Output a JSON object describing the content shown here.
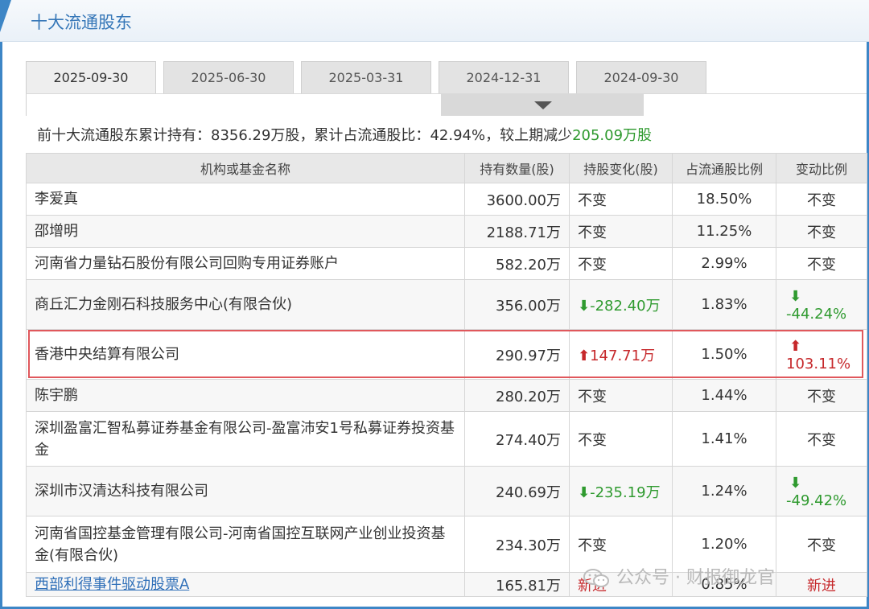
{
  "page": {
    "title": "十大流通股东"
  },
  "tabs": [
    {
      "label": "2025-09-30",
      "active": true
    },
    {
      "label": "2025-06-30",
      "active": false
    },
    {
      "label": "2025-03-31",
      "active": false
    },
    {
      "label": "2024-12-31",
      "active": false
    },
    {
      "label": "2024-09-30",
      "active": false
    }
  ],
  "summary": {
    "prefix": "前十大流通股东累计持有：",
    "total_holding": "8356.29万股",
    "ratio_label": "，累计占流通股比：",
    "ratio": "42.94%",
    "change_label": "，较上期减少",
    "change": "205.09万股"
  },
  "table": {
    "headers": [
      "机构或基金名称",
      "持有数量(股)",
      "持股变化(股)",
      "占流通股比例",
      "变动比例"
    ],
    "rows": [
      {
        "name": "李爱真",
        "quantity": "3600.00万",
        "change": "不变",
        "change_dir": "none",
        "ratio": "18.50%",
        "change_ratio": "不变",
        "ratio_dir": "none"
      },
      {
        "name": "邵增明",
        "quantity": "2188.71万",
        "change": "不变",
        "change_dir": "none",
        "ratio": "11.25%",
        "change_ratio": "不变",
        "ratio_dir": "none"
      },
      {
        "name": "河南省力量钻石股份有限公司回购专用证券账户",
        "quantity": "582.20万",
        "change": "不变",
        "change_dir": "none",
        "ratio": "2.99%",
        "change_ratio": "不变",
        "ratio_dir": "none"
      },
      {
        "name": "商丘汇力金刚石科技服务中心(有限合伙)",
        "quantity": "356.00万",
        "change": "-282.40万",
        "change_dir": "down",
        "ratio": "1.83%",
        "change_ratio": "-44.24%",
        "ratio_dir": "down"
      },
      {
        "name": "香港中央结算有限公司",
        "quantity": "290.97万",
        "change": "147.71万",
        "change_dir": "up",
        "ratio": "1.50%",
        "change_ratio": "103.11%",
        "ratio_dir": "up"
      },
      {
        "name": "陈宇鹏",
        "quantity": "280.20万",
        "change": "不变",
        "change_dir": "none",
        "ratio": "1.44%",
        "change_ratio": "不变",
        "ratio_dir": "none"
      },
      {
        "name": "深圳盈富汇智私募证券基金有限公司-盈富沛安1号私募证券投资基金",
        "quantity": "274.40万",
        "change": "不变",
        "change_dir": "none",
        "ratio": "1.41%",
        "change_ratio": "不变",
        "ratio_dir": "none"
      },
      {
        "name": "深圳市汉清达科技有限公司",
        "quantity": "240.69万",
        "change": "-235.19万",
        "change_dir": "down",
        "ratio": "1.24%",
        "change_ratio": "-49.42%",
        "ratio_dir": "down"
      },
      {
        "name": "河南省国控基金管理有限公司-河南省国控互联网产业创业投资基金(有限合伙)",
        "quantity": "234.30万",
        "change": "不变",
        "change_dir": "none",
        "ratio": "1.20%",
        "change_ratio": "不变",
        "ratio_dir": "none"
      },
      {
        "name": "西部利得事件驱动股票A",
        "quantity": "165.81万",
        "change": "新进",
        "change_dir": "new",
        "ratio": "0.85%",
        "change_ratio": "新进",
        "ratio_dir": "new",
        "is_link": true
      }
    ]
  },
  "watermark": {
    "text": "公众号 · 财报御龙官",
    "icon": "wechat-icon"
  },
  "colors": {
    "accent": "#3d86c6",
    "up": "#c6282b",
    "down": "#2f9a2f",
    "highlight": "#e0585c"
  }
}
